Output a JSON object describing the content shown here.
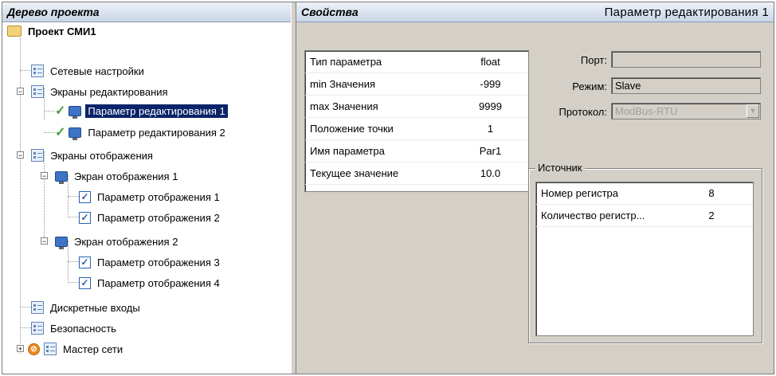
{
  "left_panel": {
    "title": "Дерево проекта",
    "project": "Проект СМИ1",
    "items": {
      "network": "Сетевые настройки",
      "edit_screens": "Экраны редактирования",
      "edit_param_1": "Параметр редактирования 1",
      "edit_param_2": "Параметр редактирования 2",
      "display_screens": "Экраны отображения",
      "display_screen_1": "Экран отображения 1",
      "display_param_1": "Параметр отображения 1",
      "display_param_2": "Параметр отображения 2",
      "display_screen_2": "Экран отображения 2",
      "display_param_3": "Параметр отображения 3",
      "display_param_4": "Параметр отображения 4",
      "discrete_inputs": "Дискретные входы",
      "security": "Безопасность",
      "network_master": "Мастер сети"
    }
  },
  "right_panel": {
    "title": "Свойства",
    "selected": "Параметр редактирования 1",
    "properties": [
      {
        "key": "Тип параметра",
        "value": "float"
      },
      {
        "key": "min Значения",
        "value": "-999"
      },
      {
        "key": "max Значения",
        "value": "9999"
      },
      {
        "key": "Положение точки",
        "value": "1"
      },
      {
        "key": "Имя параметра",
        "value": "Par1"
      },
      {
        "key": "Текущее значение",
        "value": "10.0"
      }
    ],
    "port_label": "Порт:",
    "port_value": "",
    "mode_label": "Режим:",
    "mode_value": "Slave",
    "protocol_label": "Протокол:",
    "protocol_value": "ModBus-RTU",
    "source": {
      "legend": "Источник",
      "rows": [
        {
          "key": "Номер регистра",
          "value": "8"
        },
        {
          "key": "Количество регистр...",
          "value": "2"
        }
      ]
    }
  },
  "icons": {
    "tree_plus": "plus",
    "tree_minus": "minus",
    "checkmark": "✓",
    "checkbox": "✓",
    "dropdown_arrow": "▼"
  }
}
